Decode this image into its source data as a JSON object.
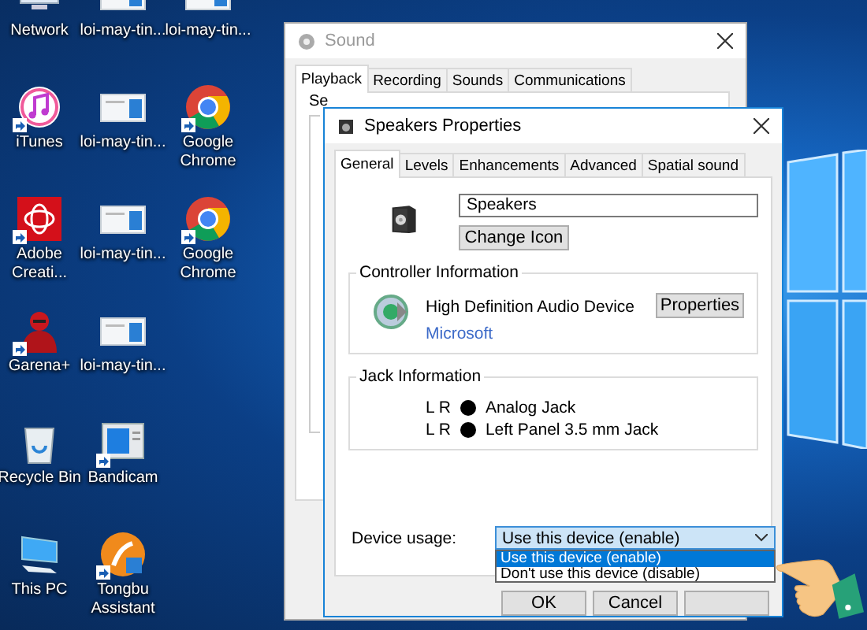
{
  "desktop": {
    "columns": [
      {
        "icons": [
          {
            "label": "Network",
            "kind": "network",
            "shortcut": false
          },
          {
            "label": "iTunes",
            "kind": "music",
            "shortcut": true
          },
          {
            "label": "Adobe Creati...",
            "kind": "creative",
            "shortcut": true
          },
          {
            "label": "Garena+",
            "kind": "mascot",
            "shortcut": true
          },
          {
            "label": "Recycle Bin",
            "kind": "bin",
            "shortcut": false
          },
          {
            "label": "This PC",
            "kind": "computer",
            "shortcut": false
          }
        ]
      },
      {
        "icons": [
          {
            "label": "loi-may-tin...",
            "kind": "thumbnail",
            "shortcut": false
          },
          {
            "label": "loi-may-tin...",
            "kind": "thumbnail",
            "shortcut": false
          },
          {
            "label": "loi-may-tin...",
            "kind": "thumbnail",
            "shortcut": false
          },
          {
            "label": "loi-may-tin...",
            "kind": "thumbnail",
            "shortcut": false
          },
          {
            "label": "Bandicam",
            "kind": "recorder",
            "shortcut": true
          },
          {
            "label": "Tongbu Assistant",
            "kind": "assistant",
            "shortcut": true
          }
        ]
      },
      {
        "icons": [
          {
            "label": "loi-may-tin...",
            "kind": "thumbnail",
            "shortcut": false
          },
          {
            "label": "Google Chrome",
            "kind": "browser",
            "shortcut": true
          },
          {
            "label": "Google Chrome",
            "kind": "browser",
            "shortcut": true
          }
        ]
      }
    ]
  },
  "sound_window": {
    "title": "Sound",
    "tabs": [
      {
        "label": "Playback",
        "selected": true
      },
      {
        "label": "Recording",
        "selected": false
      },
      {
        "label": "Sounds",
        "selected": false
      },
      {
        "label": "Communications",
        "selected": false
      }
    ],
    "instruction": "Se"
  },
  "properties_window": {
    "title": "Speakers Properties",
    "tabs": [
      {
        "label": "General",
        "selected": true
      },
      {
        "label": "Levels",
        "selected": false
      },
      {
        "label": "Enhancements",
        "selected": false
      },
      {
        "label": "Advanced",
        "selected": false
      },
      {
        "label": "Spatial sound",
        "selected": false
      }
    ],
    "device_name": "Speakers",
    "change_icon_button": "Change Icon",
    "controller": {
      "heading": "Controller Information",
      "name": "High Definition Audio Device",
      "vendor": "Microsoft",
      "button": "Properties"
    },
    "jack": {
      "heading": "Jack Information",
      "rows": [
        {
          "channels": "L R",
          "name": "Analog Jack"
        },
        {
          "channels": "L R",
          "name": "Left Panel 3.5 mm Jack"
        }
      ]
    },
    "device_usage": {
      "label": "Device usage:",
      "value": "Use this device (enable)",
      "expanded": true,
      "options": [
        {
          "label": "Use this device (enable)",
          "selected": true
        },
        {
          "label": "Don't use this device (disable)",
          "selected": false
        }
      ]
    },
    "buttons": [
      "OK",
      "Cancel"
    ]
  }
}
